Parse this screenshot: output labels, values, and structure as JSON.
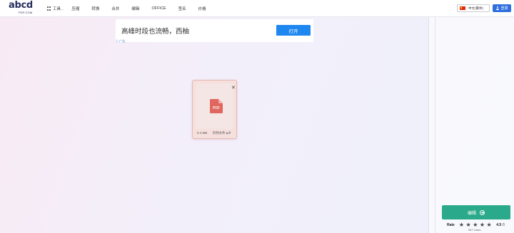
{
  "header": {
    "logo_text": "abcd",
    "logo_sub": "PDF.COM",
    "nav": [
      {
        "label": "工具",
        "has_dropdown": true,
        "icon": "grid-icon"
      },
      {
        "label": "压缩"
      },
      {
        "label": "转换"
      },
      {
        "label": "合并"
      },
      {
        "label": "编辑"
      },
      {
        "label": "OFFICE"
      },
      {
        "label": "签名"
      },
      {
        "label": "价格"
      }
    ],
    "language": "中文(繁体)",
    "login": "登录"
  },
  "ad": {
    "text": "高峰时段也流畅，西柚",
    "open_label": "打开",
    "mark": "ⓧ 广告"
  },
  "file": {
    "size": "6.4 MB",
    "name": "示例文件.pdf",
    "icon": "pdf-file-icon",
    "icon_color": "#e0675f"
  },
  "sidebar": {
    "action_label": "编辑",
    "action_color": "#2aaa8a",
    "rate_label": "Rate",
    "stars": 5,
    "score": "4.5",
    "score_max": "/5",
    "votes": "967 votes"
  }
}
